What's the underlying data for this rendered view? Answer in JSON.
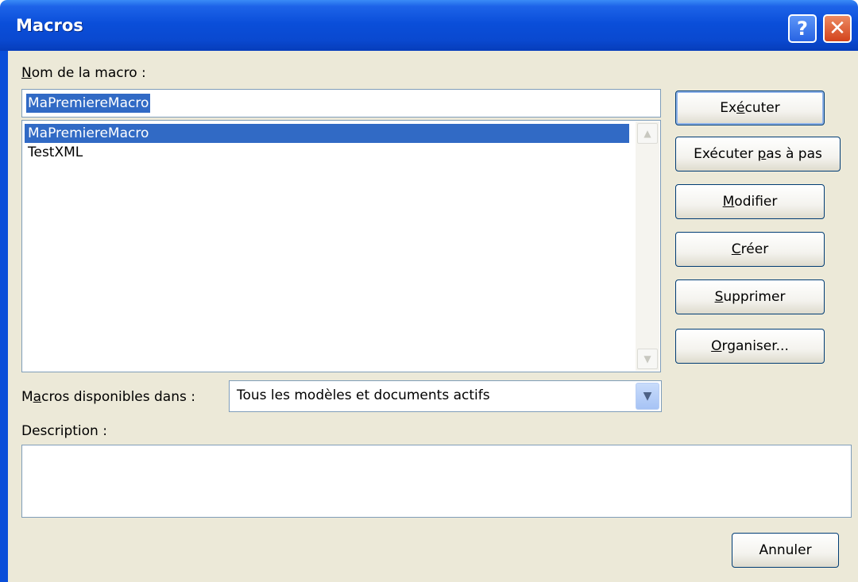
{
  "window": {
    "title": "Macros"
  },
  "titlebar": {
    "help_symbol": "?",
    "close_symbol": "✕"
  },
  "macro_name": {
    "label_accel": "N",
    "label_rest": "om de la macro :",
    "value": "MaPremiereMacro"
  },
  "macro_list": {
    "items": [
      "MaPremiereMacro",
      "TestXML"
    ],
    "selected_index": 0
  },
  "macros_in": {
    "label_first": "M",
    "label_accel": "a",
    "label_rest": "cros disponibles dans :",
    "selected": "Tous les modèles et documents actifs"
  },
  "description": {
    "label": "Description :",
    "value": ""
  },
  "buttons": {
    "run": {
      "pre": "Ex",
      "accel": "é",
      "post": "cuter"
    },
    "step": {
      "pre": "Exécuter ",
      "accel": "p",
      "post": "as à pas"
    },
    "edit": {
      "pre": "",
      "accel": "M",
      "post": "odifier"
    },
    "create": {
      "pre": "",
      "accel": "C",
      "post": "réer"
    },
    "delete": {
      "pre": "",
      "accel": "S",
      "post": "upprimer"
    },
    "organize": {
      "pre": "",
      "accel": "O",
      "post": "rganiser..."
    },
    "cancel": {
      "label": "Annuler"
    }
  },
  "colors": {
    "titlebar": "#0a4ed9",
    "dialog_bg": "#ece9d8",
    "selection": "#316ac5",
    "close_button": "#d3431c"
  }
}
